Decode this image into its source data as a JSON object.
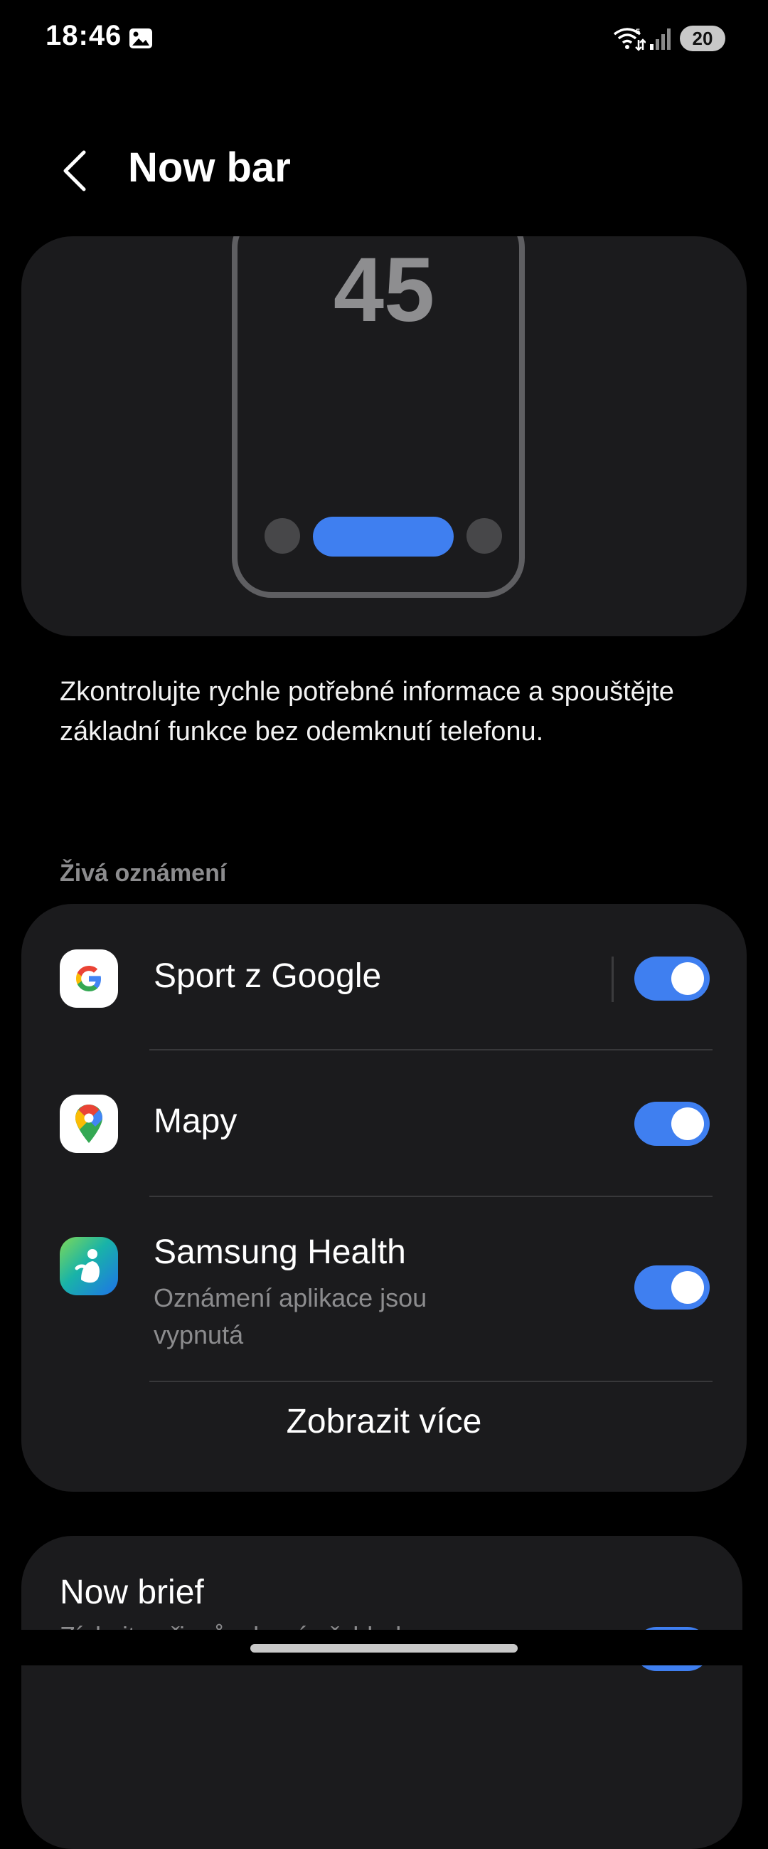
{
  "status_bar": {
    "time": "18:46",
    "battery": "20",
    "icons": [
      "gallery-icon",
      "wifi-icon",
      "signal-icon"
    ]
  },
  "header": {
    "title": "Now bar",
    "back_icon": "chevron-left-icon"
  },
  "preview": {
    "clock": "45"
  },
  "description": "Zkontrolujte rychle potřebné informace a spouštějte základní funkce bez odemknutí telefonu.",
  "live_notifications": {
    "section_label": "Živá oznámení",
    "apps": [
      {
        "name": "Sport z Google",
        "subtitle": "",
        "enabled": true,
        "icon": "google-icon"
      },
      {
        "name": "Mapy",
        "subtitle": "",
        "enabled": true,
        "icon": "maps-icon"
      },
      {
        "name": "Samsung Health",
        "subtitle": "Oznámení aplikace jsou vypnutá",
        "enabled": true,
        "icon": "samsung-health-icon"
      }
    ],
    "show_more": "Zobrazit více"
  },
  "now_brief": {
    "title": "Now brief",
    "subtitle": "Získejte přizpůsobený přehled a"
  },
  "colors": {
    "background": "#000000",
    "card": "#1b1b1d",
    "accent": "#3f7ff0",
    "secondary_text": "#8c8c8e"
  }
}
